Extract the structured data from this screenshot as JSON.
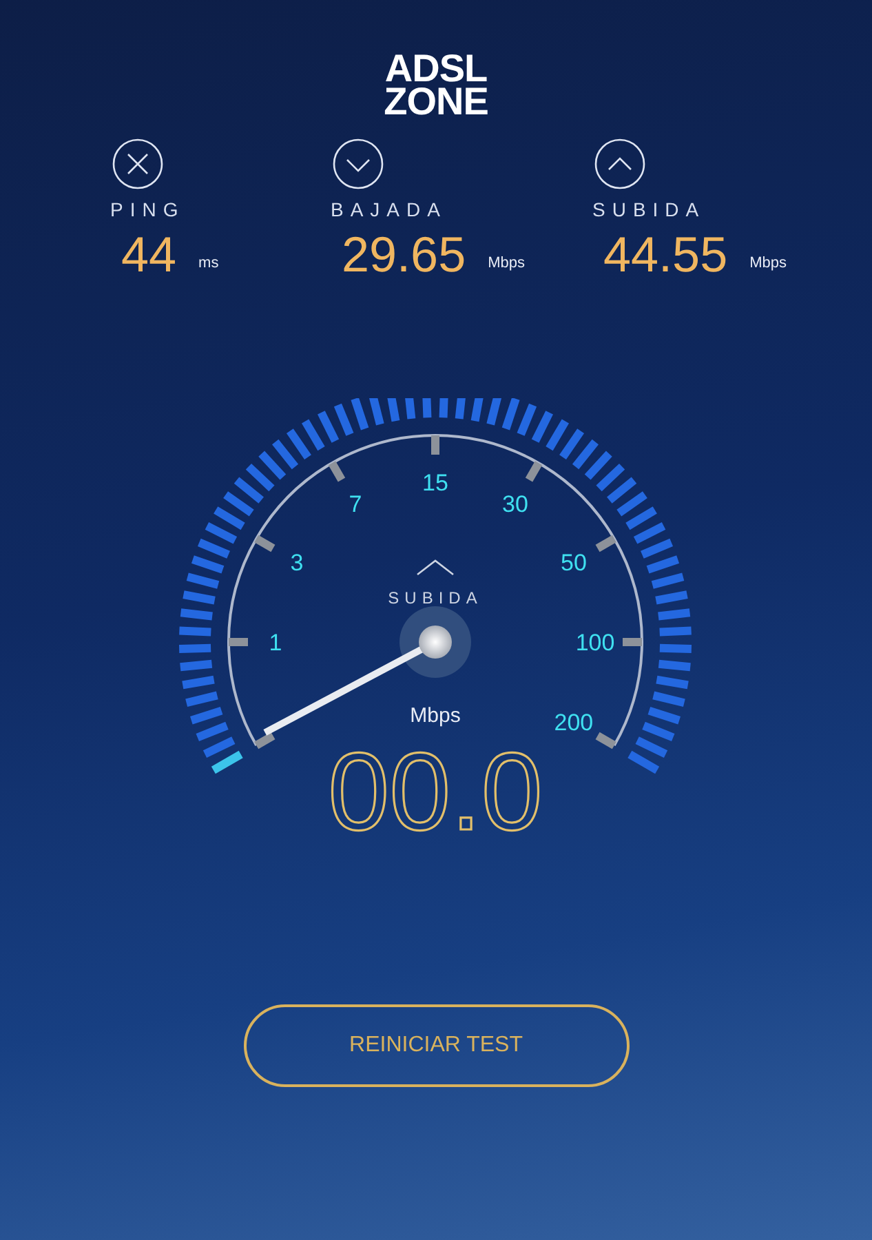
{
  "logo": {
    "line_1": "ADSL",
    "line_2": "ZONE"
  },
  "stats": [
    {
      "kind": "ping",
      "label": "PING",
      "value": "44",
      "unit": "ms"
    },
    {
      "kind": "download",
      "label": "BAJADA",
      "value": "29.65",
      "unit": "Mbps"
    },
    {
      "kind": "upload",
      "label": "SUBIDA",
      "value": "44.55",
      "unit": "Mbps"
    }
  ],
  "gauge": {
    "mode_label": "SUBIDA",
    "scale": [
      "1",
      "3",
      "7",
      "15",
      "30",
      "50",
      "100",
      "200"
    ],
    "unit": "Mbps",
    "reading": "00.0"
  },
  "button": {
    "label": "REINICIAR TEST"
  }
}
